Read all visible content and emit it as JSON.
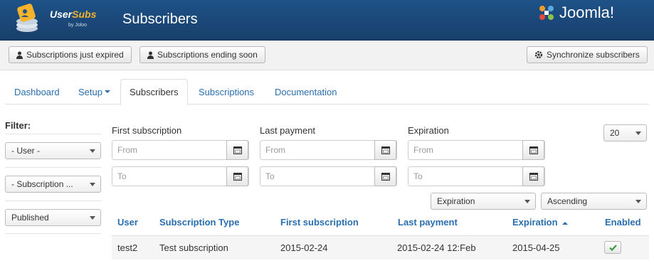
{
  "header": {
    "logo_text_primary": "User",
    "logo_text_accent": "Subs",
    "logo_sub": "by Joloo",
    "page_title": "Subscribers",
    "brand": "Joomla!"
  },
  "toolbar": {
    "expired_label": "Subscriptions just expired",
    "ending_label": "Subscriptions ending soon",
    "sync_label": "Synchronize subscribers"
  },
  "tabs": [
    {
      "label": "Dashboard"
    },
    {
      "label": "Setup"
    },
    {
      "label": "Subscribers"
    },
    {
      "label": "Subscriptions"
    },
    {
      "label": "Documentation"
    }
  ],
  "filters": {
    "title": "Filter:",
    "user": "- User -",
    "subscription": "- Subscription ...",
    "status": "Published",
    "limit": "20"
  },
  "date_filters": {
    "first_subscription": {
      "label": "First subscription",
      "from": "From",
      "to": "To"
    },
    "last_payment": {
      "label": "Last payment",
      "from": "From",
      "to": "To"
    },
    "expiration": {
      "label": "Expiration",
      "from": "From",
      "to": "To"
    }
  },
  "sorting": {
    "field": "Expiration",
    "direction": "Ascending"
  },
  "table": {
    "headers": [
      "User",
      "Subscription Type",
      "First subscription",
      "Last payment",
      "Expiration",
      "Enabled"
    ],
    "rows": [
      {
        "user": "test2",
        "type": "Test subscription",
        "first": "2015-02-24",
        "last_payment": "2015-02-24 12:Feb",
        "expiration": "2015-04-25",
        "enabled": true
      }
    ]
  },
  "colors": {
    "header_bg": "#1f5288",
    "link": "#2a6eb0",
    "enabled_check": "#3c9a3c"
  },
  "icons": [
    "usersubs-logo-icon",
    "joomla-logo-icon",
    "user-icon",
    "gear-icon",
    "calendar-icon",
    "check-icon",
    "sort-asc-icon",
    "caret-down-icon"
  ]
}
